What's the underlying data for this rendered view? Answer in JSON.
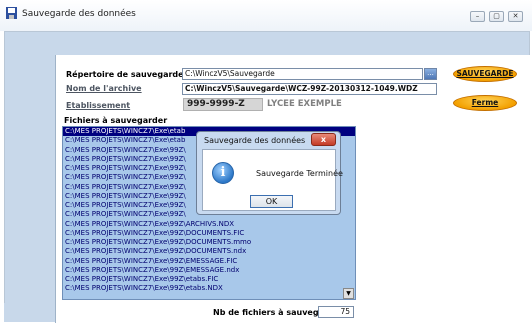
{
  "window": {
    "title": "Sauvegarde des données",
    "controls": {
      "minimize": "–",
      "maximize": "▢",
      "close": "✕"
    }
  },
  "form": {
    "repertoire_label": "Répertoire de sauvegarde",
    "repertoire_value": "C:\\WinczV5\\Sauvegarde",
    "browse_label": "...",
    "archive_label": "Nom de l'archive",
    "archive_value": "C:\\WinczV5\\Sauvegarde\\WCZ-99Z-20130312-1049.WDZ",
    "etablissement_label": "Etablissement",
    "etablissement_code": "999-9999-Z",
    "etablissement_name": "LYCEE EXEMPLE",
    "fichiers_label": "Fichiers à sauvegarder",
    "count_label": "Nb de fichiers à sauvegar",
    "count_value": "75"
  },
  "buttons": {
    "sauvegarde": "SAUVEGARDE",
    "fermer": "Ferme"
  },
  "files": [
    "C:\\MES PROJETS\\WINCZ7\\Exe\\etab",
    "C:\\MES PROJETS\\WINCZ7\\Exe\\etab",
    "C:\\MES PROJETS\\WINCZ7\\Exe\\99Z\\",
    "C:\\MES PROJETS\\WINCZ7\\Exe\\99Z\\",
    "C:\\MES PROJETS\\WINCZ7\\Exe\\99Z\\",
    "C:\\MES PROJETS\\WINCZ7\\Exe\\99Z\\",
    "C:\\MES PROJETS\\WINCZ7\\Exe\\99Z\\",
    "C:\\MES PROJETS\\WINCZ7\\Exe\\99Z\\",
    "C:\\MES PROJETS\\WINCZ7\\Exe\\99Z\\",
    "C:\\MES PROJETS\\WINCZ7\\Exe\\99Z\\",
    "C:\\MES PROJETS\\WINCZ7\\Exe\\99Z\\ARCHIVS.NDX",
    "C:\\MES PROJETS\\WINCZ7\\Exe\\99Z\\DOCUMENTS.FIC",
    "C:\\MES PROJETS\\WINCZ7\\Exe\\99Z\\DOCUMENTS.mmo",
    "C:\\MES PROJETS\\WINCZ7\\Exe\\99Z\\DOCUMENTS.ndx",
    "C:\\MES PROJETS\\WINCZ7\\Exe\\99Z\\EMESSAGE.FIC",
    "C:\\MES PROJETS\\WINCZ7\\Exe\\99Z\\EMESSAGE.ndx",
    "C:\\MES PROJETS\\WINCZ7\\Exe\\99Z\\etabs.FIC",
    "C:\\MES PROJETS\\WINCZ7\\Exe\\99Z\\etabs.NDX"
  ],
  "dialog": {
    "title": "Sauvegarde des données",
    "message": "Sauvegarde Terminée",
    "ok_label": "OK",
    "close_glyph": "x",
    "icon_glyph": "i"
  }
}
